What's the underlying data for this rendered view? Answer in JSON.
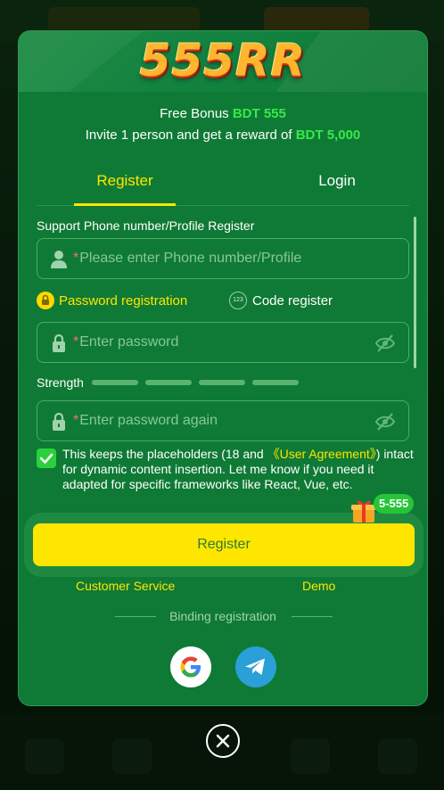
{
  "brand": {
    "logo_text": "555RR"
  },
  "promo": {
    "line1_prefix": "Free Bonus ",
    "line1_highlight": "BDT 555",
    "line2_prefix": "Invite 1 person and get a reward of ",
    "line2_highlight": "BDT 5,000"
  },
  "tabs": [
    {
      "label": "Register",
      "active": true
    },
    {
      "label": "Login",
      "active": false
    }
  ],
  "form": {
    "support_label": "Support Phone number/Profile Register",
    "phone_placeholder": "Please enter Phone number/Profile",
    "required_mark": "*",
    "modes": {
      "password_label": "Password registration",
      "code_label": "Code register",
      "code_icon_text": "123",
      "selected": "password"
    },
    "password_placeholder": "Enter password",
    "strength_label": "Strength",
    "strength_segments": 4,
    "password_again_placeholder": "Enter password again",
    "agreement": {
      "checked": true,
      "text_before": "This keeps the placeholders (18 and ",
      "link_text": "《User Agreement》",
      "text_after": ") intact for dynamic content insertion. Let me know if you need it adapted for specific frameworks like React, Vue, etc."
    },
    "bonus_badge": "5-555",
    "register_button": "Register"
  },
  "links": {
    "customer_service": "Customer Service",
    "demo": "Demo"
  },
  "binding_label": "Binding registration",
  "social": [
    {
      "name": "google",
      "icon": "google-icon"
    },
    {
      "name": "telegram",
      "icon": "telegram-icon"
    }
  ],
  "colors": {
    "modal_bg": "#0f7a35",
    "accent_yellow": "#ffe600",
    "highlight_green": "#39e84a",
    "placeholder": "#86c898"
  }
}
